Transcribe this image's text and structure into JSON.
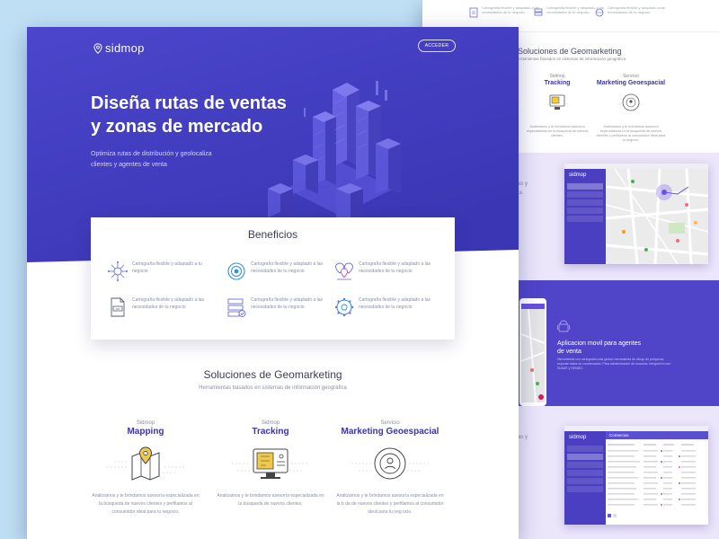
{
  "front": {
    "logo": "sidmop",
    "acceder_label": "ACCEDER",
    "hero": {
      "title_line1": "Diseña rutas de ventas",
      "title_line2": "y zonas de mercado",
      "subtitle_line1": "Optimiza rutas de distribución y geolocaliza",
      "subtitle_line2": "clientes y agentes de venta"
    },
    "beneficios": {
      "title": "Beneficios",
      "items": [
        {
          "icon": "network-grid-icon",
          "text": "Cartografía flexible y adaptado a tu negocio"
        },
        {
          "icon": "target-icon",
          "text": "Cartografía flexible y adaptado a las necesidades de tu negocio"
        },
        {
          "icon": "location-pins-icon",
          "text": "Cartografía flexible y adaptado a las necesidades de tu negocio"
        },
        {
          "icon": "document-api-icon",
          "text": "Cartografía flexible y adaptado a las necesidades de tu negocio"
        },
        {
          "icon": "server-check-icon",
          "text": "Cartografía flexible y adaptado a las necesidades de tu negocio"
        },
        {
          "icon": "globe-network-icon",
          "text": "Cartografía flexible y adaptado a las necesidades de tu negocio"
        }
      ]
    },
    "soluciones": {
      "title": "Soluciones de Geomarketing",
      "subtitle": "Herramientas basados en sistemas de información geográfica",
      "cards": [
        {
          "small": "Sidmop",
          "name": "Mapping",
          "icon": "map-pin-icon",
          "text": "Analizamos y te brindamos asesoría especializada en la búsqueda de nuevos clientes y perfilamos al consumidor ideal para tu negocio."
        },
        {
          "small": "Sidmop",
          "name": "Tracking",
          "icon": "monitor-map-icon",
          "text": "Analizamos y te brindamos asesoría especializada en la búsqueda de nuevos clientes."
        },
        {
          "small": "Servicio",
          "name": "Marketing Geoespacial",
          "icon": "user-target-icon",
          "text": "Analizamos y te brindamos asesoría especializada en la b da de nuevos clientes y perfilamos al consumidor ideal para tu neg ocio."
        }
      ]
    }
  },
  "back": {
    "top_items": [
      "Cartografía flexible y adaptado a las necesidades de tu negocio",
      "Cartografía flexible y adaptado a las necesidades de tu negocio",
      "Cartografía flexible y adaptado a las necesidades de tu negocio"
    ],
    "soluciones_title": "Soluciones de Geomarketing",
    "soluciones_sub": "erramientas basados en sistemas de información geográfica",
    "cards": [
      {
        "small": "Sidmop",
        "name": "Tracking",
        "text": "Analizamos y te brindamos asesoría especializada en la búsqueda de nuevos clientes."
      },
      {
        "small": "Servicio",
        "name": "Marketing Geoespacial",
        "text": "Analizamos y te brindamos asesoría especializada en la búsqueda de nuevos clientes y perfilamos al consumidor ideal para tu negocio."
      }
    ],
    "mock1_logo": "sidmop",
    "app_title_line1": "Aplicacion movil para agentes",
    "app_title_line2": "de venta",
    "app_body": "Herramienta con cartografía más global, herramienta de dibujo de polígonos, exportar datos en coordenadas. Para administración de usuarios. Integración con SUNAT y RENIEC.",
    "mock2_logo": "sidmop",
    "mock2_heading": "Comercios"
  },
  "colors": {
    "hero_top": "#4b46cc",
    "hero_bottom": "#3d3ab8",
    "accent": "#3a35a8"
  }
}
